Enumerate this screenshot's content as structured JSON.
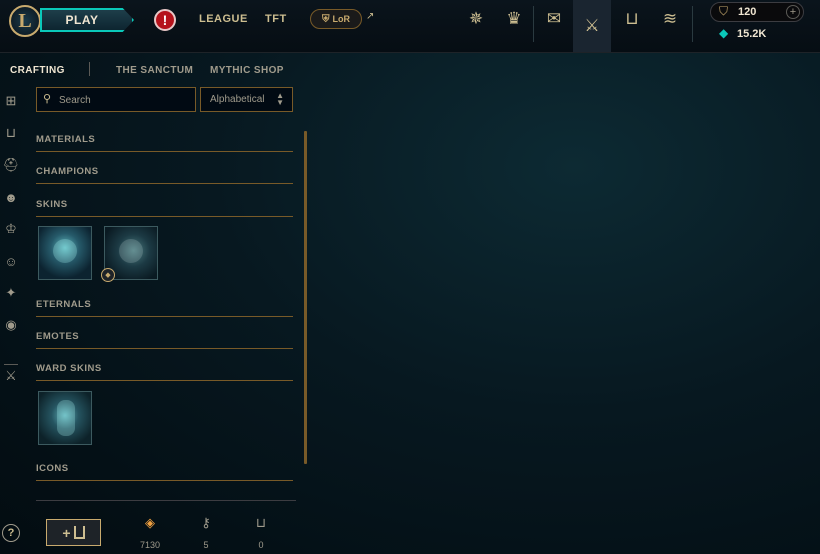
{
  "nav": {
    "logo_letter": "L",
    "play_label": "PLAY",
    "alert_glyph": "!",
    "links": [
      "LEAGUE",
      "TFT"
    ],
    "lor_label": "LoR",
    "external_glyph": "↗",
    "icons": [
      "compass-icon",
      "trophy-icon",
      "mailbox-icon",
      "crossed-swords-icon",
      "loot-chest-icon",
      "coin-stack-icon"
    ]
  },
  "currency": {
    "rp": "120",
    "blue_essence": "15.2K",
    "add_glyph": "+"
  },
  "subtabs": [
    "CRAFTING",
    "THE SANCTUM",
    "MYTHIC SHOP"
  ],
  "filter": {
    "search_placeholder": "Search",
    "sort_selected": "Alphabetical",
    "search_glyph": "🔍",
    "sort_glyph": "⬍"
  },
  "categories": [
    "MATERIALS",
    "CHAMPIONS",
    "SKINS",
    "ETERNALS",
    "EMOTES",
    "WARD SKINS",
    "ICONS"
  ],
  "rail_icons": [
    "grid-icon",
    "chest-icon",
    "helmet-icon",
    "mask-icon",
    "crown-icon",
    "emote-icon",
    "ward-icon",
    "profile-icon",
    "swords-icon"
  ],
  "help_label": "?",
  "bottom": {
    "open_label": "+",
    "orange_essence": "7130",
    "keys": "5",
    "chests": "0"
  },
  "colors": {
    "gold": "#c8aa6e",
    "teal": "#0ac8b9",
    "orange_essence": "#f0a040"
  }
}
